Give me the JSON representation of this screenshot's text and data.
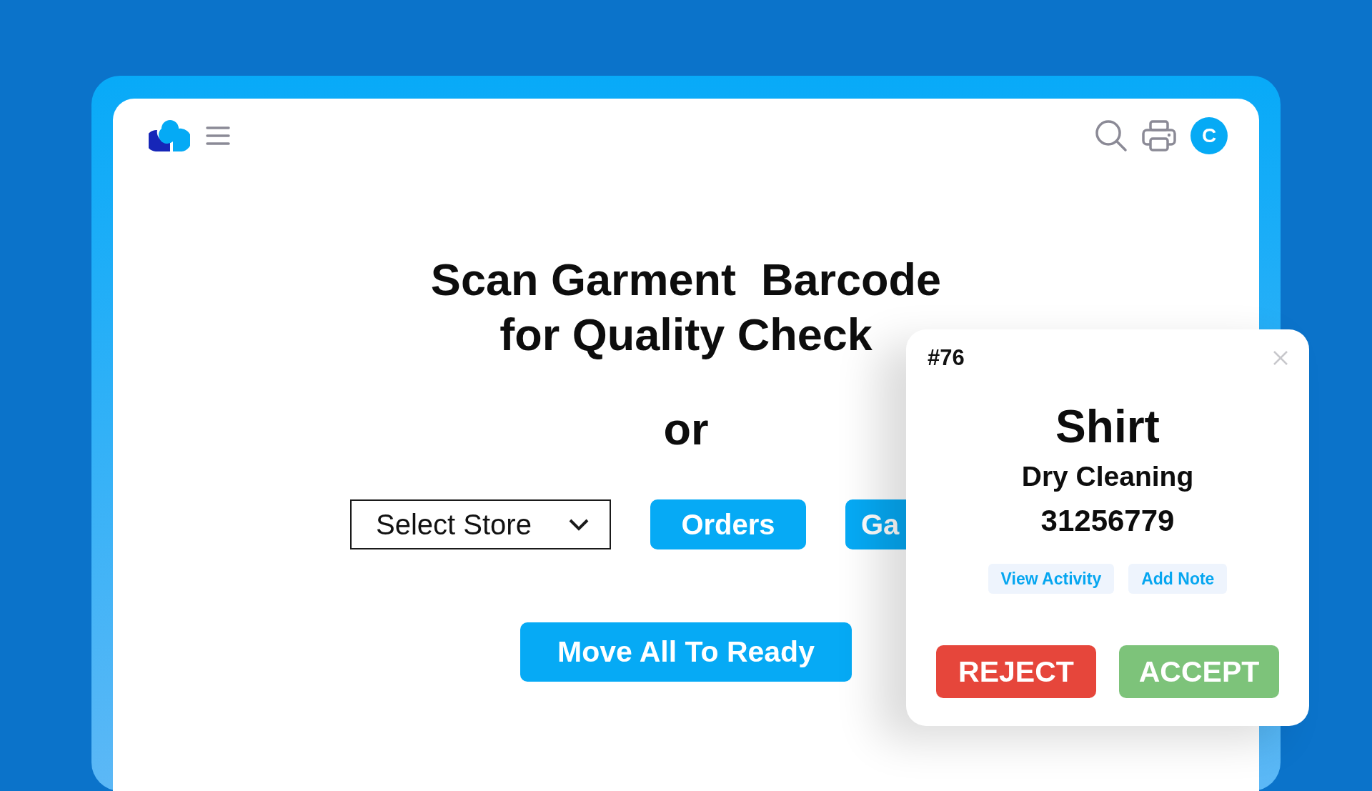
{
  "header": {
    "avatar_initial": "C"
  },
  "title": [
    "Scan Garment  Barcode",
    "for Quality Check"
  ],
  "separator": "or",
  "store_select": {
    "value": "Select Store"
  },
  "buttons": [
    {
      "label": "Orders"
    },
    {
      "label": "Ga"
    }
  ],
  "move_button": "Move All To Ready",
  "popup": {
    "order_number": "#76",
    "item": "Shirt",
    "service": "Dry Cleaning",
    "barcode": "31256779",
    "links": [
      "View Activity",
      "Add Note"
    ],
    "actions": [
      {
        "label": "REJECT",
        "kind": "reject"
      },
      {
        "label": "ACCEPT",
        "kind": "accept"
      }
    ]
  }
}
